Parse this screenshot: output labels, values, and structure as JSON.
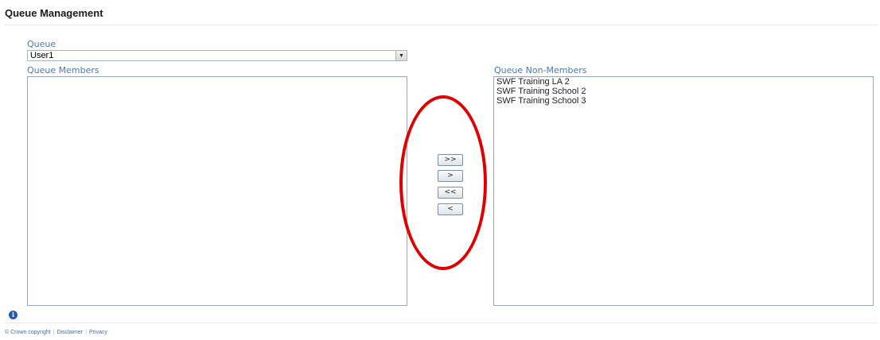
{
  "page": {
    "title": "Queue Management"
  },
  "queue": {
    "label": "Queue",
    "selected": "User1"
  },
  "members": {
    "label": "Queue Members",
    "items": []
  },
  "non_members": {
    "label": "Queue Non-Members",
    "items": [
      "SWF Training LA 2",
      "SWF Training School 2",
      "SWF Training School 3"
    ]
  },
  "transfer_buttons": {
    "move_all_right": ">>",
    "move_right": ">",
    "move_all_left": "<<",
    "move_left": "<"
  },
  "annotation": {
    "ellipse_color": "#e00000"
  },
  "icons": {
    "info": "info-icon",
    "dropdown": "chevron-down-icon"
  },
  "footer": {
    "copyright": "© Crown copyright",
    "disclaimer": "Disclaimer",
    "privacy": "Privacy"
  }
}
